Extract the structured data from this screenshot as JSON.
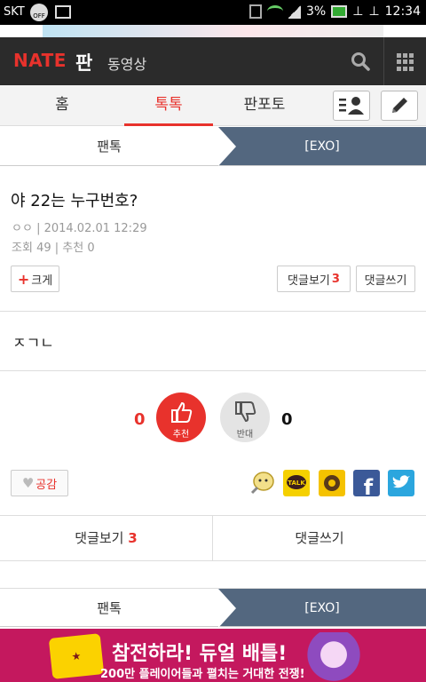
{
  "status_bar": {
    "carrier": "SKT",
    "off_label": "OFF",
    "battery_percent": "3%",
    "time": "12:34"
  },
  "header": {
    "logo_nate": "NATE",
    "logo_pan": "판",
    "video_label": "동영상",
    "icons": [
      "search-icon",
      "grid-icon"
    ]
  },
  "tabs": {
    "items": [
      {
        "label": "홈"
      },
      {
        "label": "톡톡"
      },
      {
        "label": "판포토"
      }
    ],
    "active_index": 1
  },
  "category": {
    "left": "팬톡",
    "right": "[EXO]"
  },
  "article": {
    "title": "야 22는 누구번호?",
    "author": "ㅇㅇ",
    "date": "2014.02.01 12:29",
    "views_label": "조회",
    "views": "49",
    "recommend_label": "추천",
    "recommend": "0",
    "zoom_label": "크게",
    "comments_view_label": "댓글보기",
    "comments_count": "3",
    "comment_write_label": "댓글쓰기",
    "body": "ㅈㄱㄴ"
  },
  "vote": {
    "up_count": "0",
    "up_label": "추천",
    "down_label": "반대",
    "down_count": "0"
  },
  "social": {
    "empathy_label": "공감",
    "icons": [
      "emoticon-icon",
      "kakaotalk-icon",
      "kakaostory-icon",
      "facebook-icon",
      "twitter-icon"
    ]
  },
  "bottom_buttons": {
    "view_label": "댓글보기",
    "view_count": "3",
    "write_label": "댓글쓰기"
  },
  "category_bottom": {
    "left": "팬톡",
    "right": "[EXO]"
  },
  "ad": {
    "main_text": "참전하라! 듀얼 배틀!",
    "sub_text": "200만 플레이어들과 펼치는 거대한 전쟁!"
  },
  "colors": {
    "accent": "#e8322c",
    "header_bg": "#2b2b2b",
    "category_right_bg": "#53677f",
    "ad_bg": "#c4185e"
  }
}
